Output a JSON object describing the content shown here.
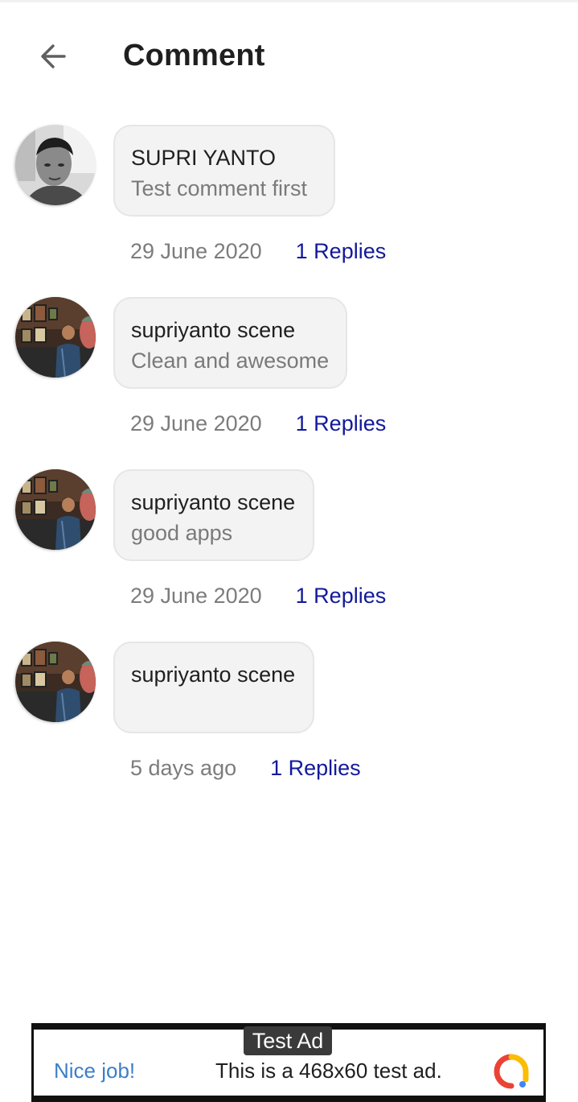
{
  "header": {
    "title": "Comment",
    "back_icon": "arrow-left-icon"
  },
  "comments": [
    {
      "author": "SUPRI YANTO",
      "text": "Test comment first",
      "date": "29 June 2020",
      "replies": "1 Replies",
      "avatar": "portrait-photo"
    },
    {
      "author": "supriyanto scene",
      "text": "Clean and awesome",
      "date": "29 June 2020",
      "replies": "1 Replies",
      "avatar": "gallery-photo"
    },
    {
      "author": "supriyanto scene",
      "text": "good apps",
      "date": "29 June 2020",
      "replies": "1 Replies",
      "avatar": "gallery-photo"
    },
    {
      "author": "supriyanto scene",
      "text": "",
      "date": "5 days ago",
      "replies": "1 Replies",
      "avatar": "gallery-photo"
    }
  ],
  "ad": {
    "label": "Test Ad",
    "nice": "Nice job!",
    "text": "This is a 468x60 test ad.",
    "logo_icon": "admob-logo-icon"
  },
  "colors": {
    "link": "#13199a",
    "ad_link": "#3c7ec8",
    "bubble_bg": "#f3f3f3"
  }
}
